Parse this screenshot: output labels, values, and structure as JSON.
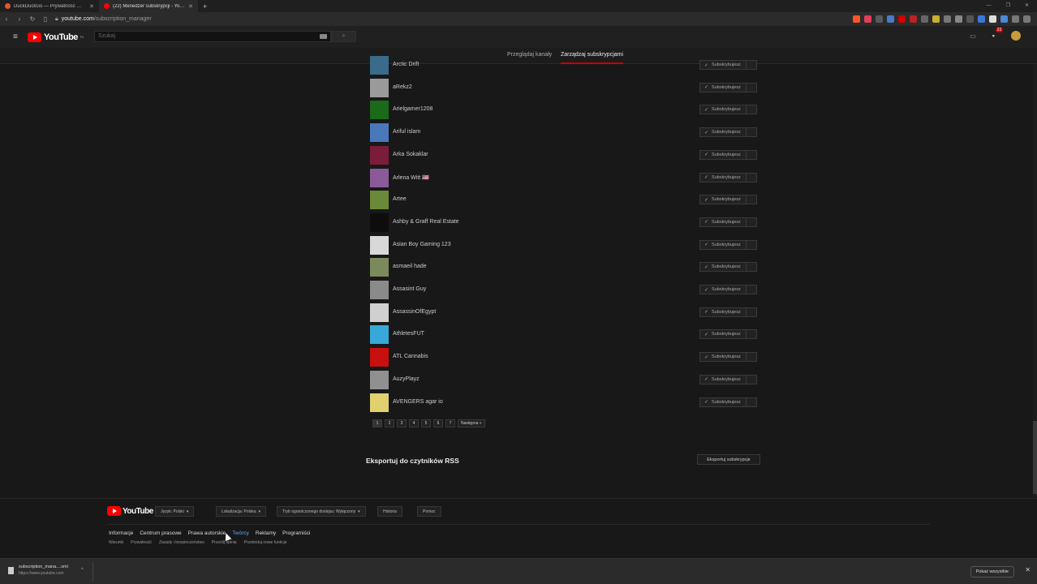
{
  "browser": {
    "tabs": [
      {
        "title": "DuckDuckGo — Prywatność — je...",
        "favicon_color": "#de5833",
        "active": false
      },
      {
        "title": "(22) Menedżer subskrypcji - YouTube",
        "favicon_color": "#ff0000",
        "active": true
      }
    ],
    "url_host": "youtube.com",
    "url_path": "/subscription_manager"
  },
  "youtube_header": {
    "logo_text": "YouTube",
    "region": "PL",
    "search_placeholder": "Szukaj",
    "notification_count": "22"
  },
  "subtabs": [
    {
      "label": "Przeglądaj kanały",
      "active": false
    },
    {
      "label": "Zarządzaj subskrypcjami",
      "active": true
    }
  ],
  "subscribe_label": "Subskrybujesz",
  "channels": [
    {
      "name": "Arctic Drift",
      "thumb_color": "#3a6b8a"
    },
    {
      "name": "aRekz2",
      "thumb_color": "#9a9a9a"
    },
    {
      "name": "Arielgamer1208",
      "thumb_color": "#1a6a1a"
    },
    {
      "name": "Ariful islam",
      "thumb_color": "#4a78b8"
    },
    {
      "name": "Arka Sokaklar",
      "thumb_color": "#7a1c3a"
    },
    {
      "name": "Arlena Witt 🇺🇸",
      "thumb_color": "#8a5a9a"
    },
    {
      "name": "Artee",
      "thumb_color": "#6a8a3a"
    },
    {
      "name": "Ashby & Graff Real Estate",
      "thumb_color": "#0d0d0d"
    },
    {
      "name": "Asian Boy Gaming 123",
      "thumb_color": "#d8d8d8"
    },
    {
      "name": "asmaeil hade",
      "thumb_color": "#7a8a5a"
    },
    {
      "name": "Assasint Guy",
      "thumb_color": "#8a8a8a"
    },
    {
      "name": "AssassinOfEgypt",
      "thumb_color": "#d0d0d0"
    },
    {
      "name": "AthletesFUT",
      "thumb_color": "#38a8d8"
    },
    {
      "name": "ATL Cannabis",
      "thumb_color": "#c81010"
    },
    {
      "name": "AuzyPlayz",
      "thumb_color": "#909090"
    },
    {
      "name": "AVENGERS agar io",
      "thumb_color": "#e0d070"
    }
  ],
  "pagination": {
    "pages": [
      "1",
      "2",
      "3",
      "4",
      "5",
      "6",
      "7"
    ],
    "current": "1",
    "next_label": "Następna »"
  },
  "export": {
    "title": "Eksportuj do czytników RSS",
    "button_label": "Eksportuj subskrypcje"
  },
  "footer": {
    "logo_text": "YouTube",
    "buttons": [
      {
        "label": "Język: Polski",
        "caret": true
      },
      {
        "label": "Lokalizacja: Polska",
        "caret": true
      },
      {
        "label": "Tryb ograniczonego dostępu: Wyłączony",
        "caret": true
      },
      {
        "label": "Historia",
        "caret": false
      },
      {
        "label": "Pomoc",
        "caret": false
      }
    ],
    "links": [
      {
        "label": "Informacje",
        "highlight": false
      },
      {
        "label": "Centrum prasowe",
        "highlight": false
      },
      {
        "label": "Prawa autorskie",
        "highlight": false
      },
      {
        "label": "Twórcy",
        "highlight": true
      },
      {
        "label": "Reklamy",
        "highlight": false
      },
      {
        "label": "Programiści",
        "highlight": false
      }
    ],
    "links2": [
      "Warunki",
      "Prywatność",
      "Zasady i bezpieczeństwo",
      "Prześlij opinię",
      "Przetestuj nowe funkcje"
    ]
  },
  "downloads": {
    "file_name": "subscription_mana....xml",
    "file_url": "https://www.youtube.com",
    "show_all_label": "Pokaż wszystkie"
  }
}
